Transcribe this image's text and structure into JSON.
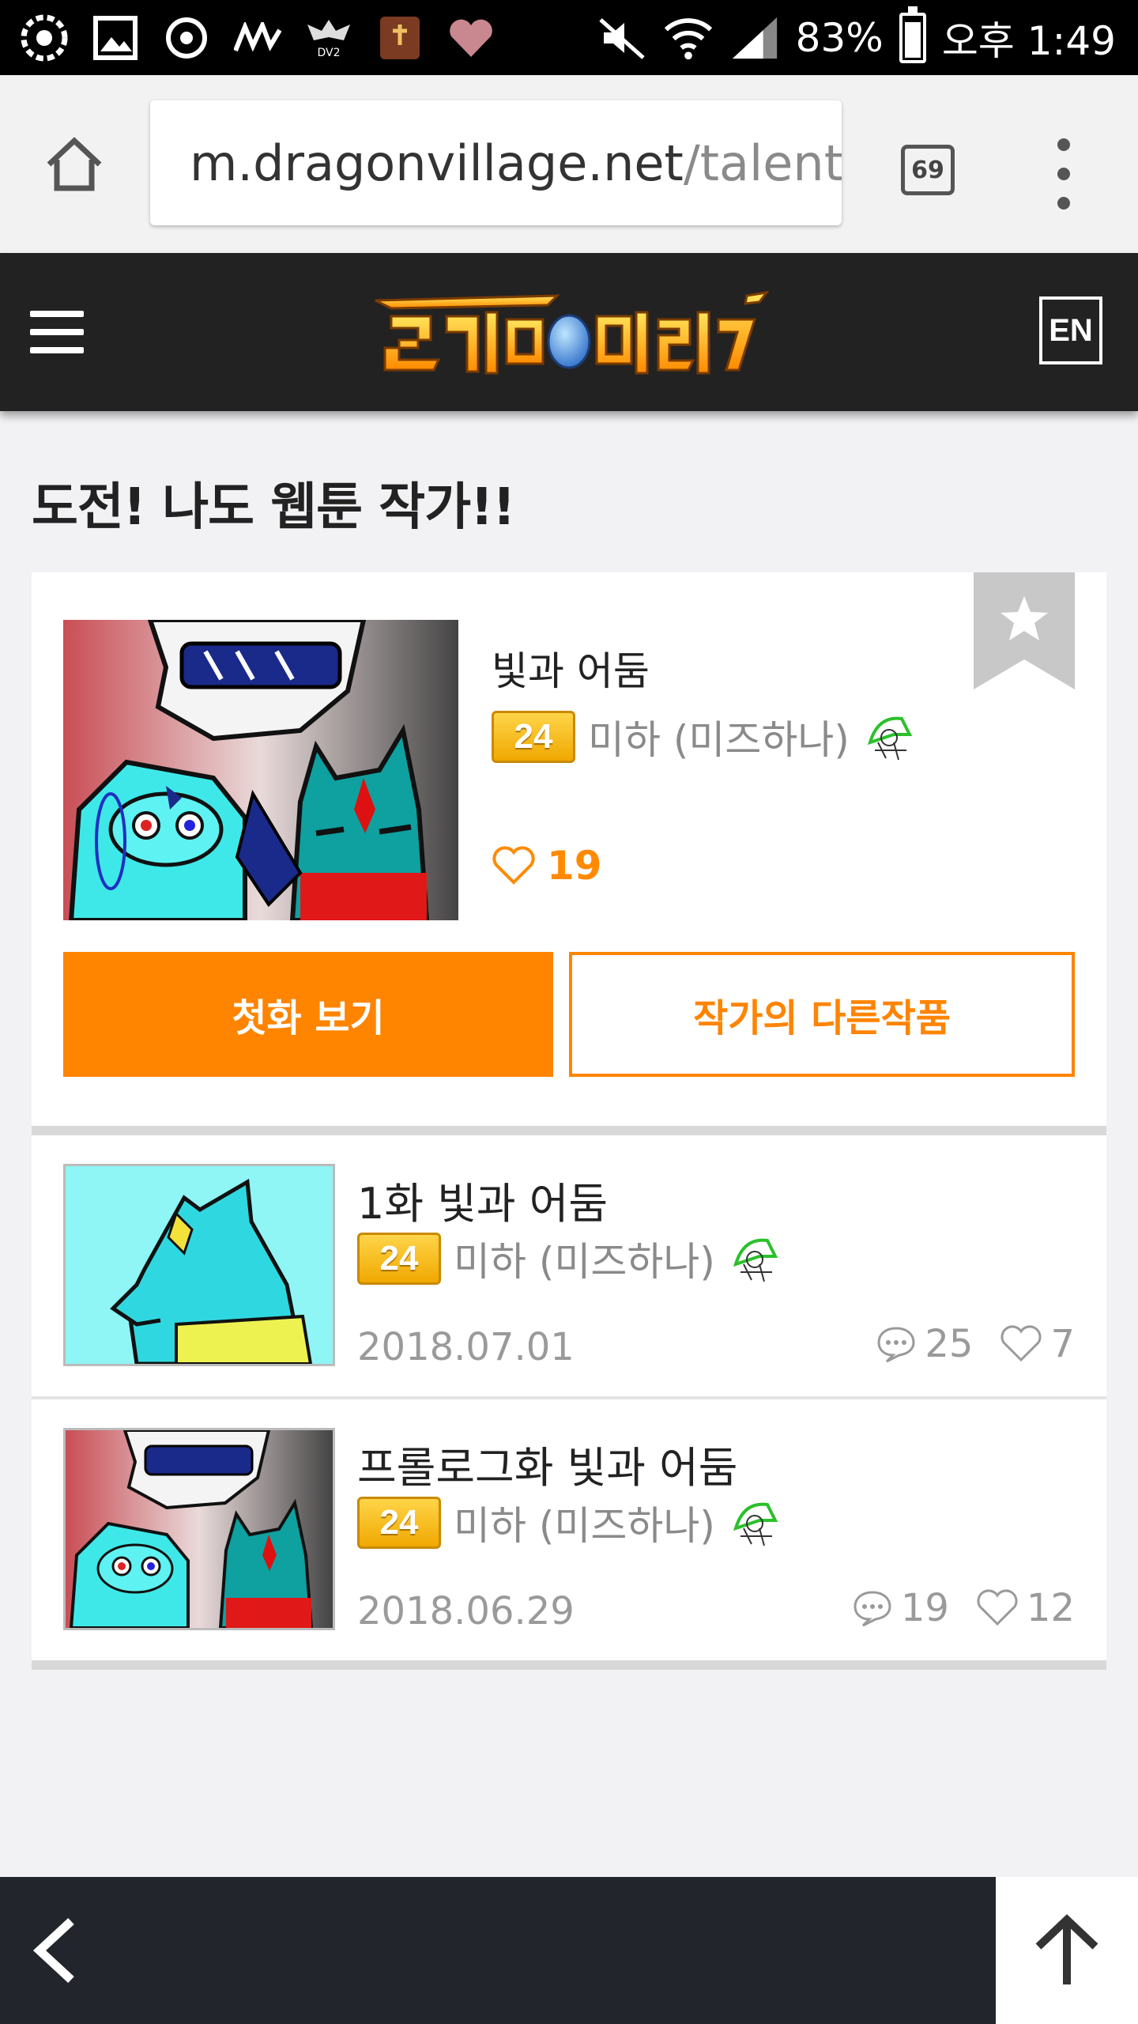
{
  "status_bar": {
    "battery": "83%",
    "time": "오후 1:49"
  },
  "browser": {
    "url_domain": "m.dragonvillage.net",
    "url_path": "/talent/l",
    "tab_count": "69"
  },
  "site": {
    "lang_button": "EN"
  },
  "page_title": "도전! 나도 웹툰 작가!!",
  "featured": {
    "title": "빛과 어둠",
    "level": "24",
    "author": "미하 (미즈하나)",
    "likes": "19",
    "first_episode_button": "첫화 보기",
    "other_works_button": "작가의 다른작품"
  },
  "episodes": [
    {
      "title": "1화 빛과 어둠",
      "level": "24",
      "author": "미하 (미즈하나)",
      "date": "2018.07.01",
      "comments": "25",
      "likes": "7"
    },
    {
      "title": "프롤로그화 빛과 어둠",
      "level": "24",
      "author": "미하 (미즈하나)",
      "date": "2018.06.29",
      "comments": "19",
      "likes": "12"
    }
  ],
  "colors": {
    "accent": "#ff8400",
    "header_bg": "#222222",
    "bottom_bar_bg": "#22252c"
  }
}
